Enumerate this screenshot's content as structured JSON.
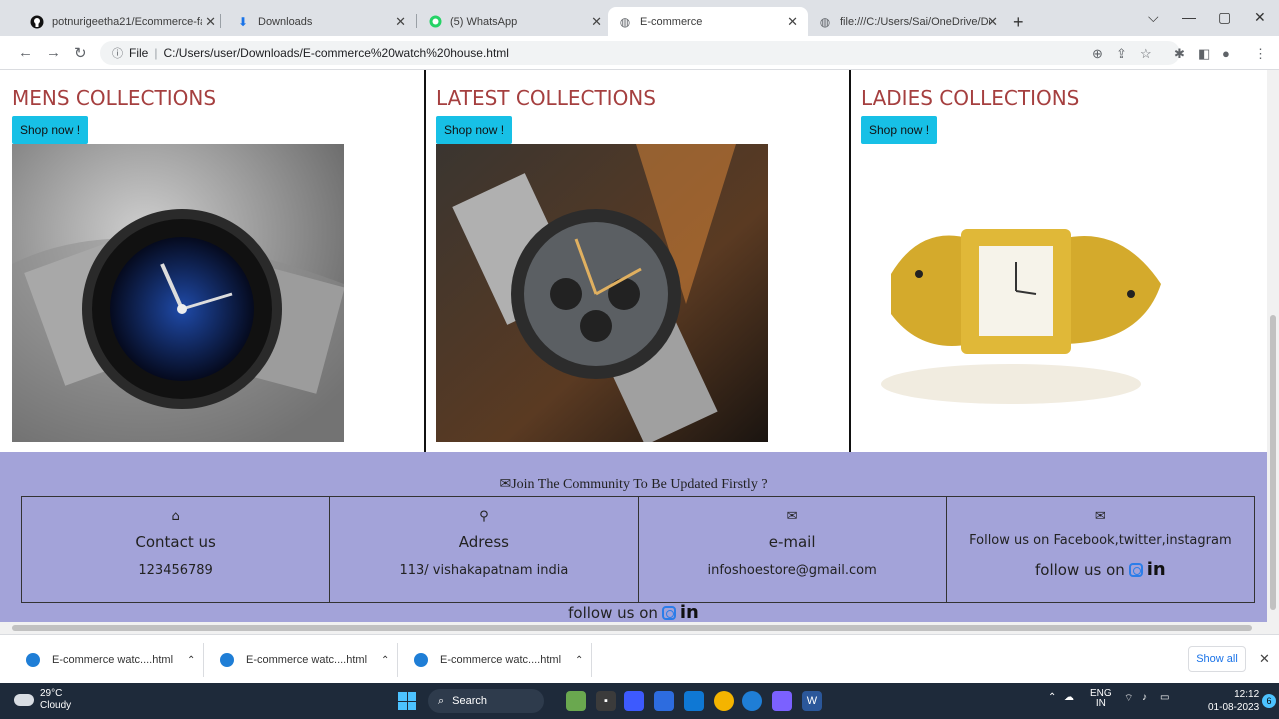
{
  "browser": {
    "tabs": [
      {
        "title": "potnurigeetha21/Ecommerce-fa",
        "icon": "github-icon"
      },
      {
        "title": "Downloads",
        "icon": "download-icon"
      },
      {
        "title": "(5) WhatsApp",
        "icon": "whatsapp-icon"
      },
      {
        "title": "E-commerce",
        "icon": "globe-icon"
      },
      {
        "title": "file:///C:/Users/Sai/OneDrive/De",
        "icon": "globe-icon"
      }
    ],
    "active_tab": 3,
    "address_prefix": "File",
    "url": "C:/Users/user/Downloads/E-commerce%20watch%20house.html"
  },
  "collections": [
    {
      "title": "MENS COLLECTIONS",
      "button": "Shop now !"
    },
    {
      "title": "LATEST COLLECTIONS",
      "button": "Shop now !"
    },
    {
      "title": "LADIES COLLECTIONS",
      "button": "Shop now !"
    }
  ],
  "footer": {
    "join_text": "Join The Community To Be Updated Firstly ?",
    "cells": [
      {
        "icon": "home-icon",
        "title": "Contact us",
        "value": "123456789"
      },
      {
        "icon": "location-pin-icon",
        "title": "Adress",
        "value": "113/ vishakapatnam india"
      },
      {
        "icon": "envelope-icon",
        "title": "e-mail",
        "value": "infoshoestore@gmail.com"
      },
      {
        "icon": "envelope-icon",
        "title": "Follow us on Facebook,twitter,instagram",
        "value": "follow us on"
      }
    ],
    "follow_bottom": "follow us on",
    "linkedin": "in"
  },
  "downloads": {
    "items": [
      "E-commerce watc....html",
      "E-commerce watc....html",
      "E-commerce watc....html"
    ],
    "show_all": "Show all"
  },
  "taskbar": {
    "temperature": "29°C",
    "weather": "Cloudy",
    "search": "Search",
    "lang_top": "ENG",
    "lang_bottom": "IN",
    "time": "12:12",
    "date": "01-08-2023",
    "notifications": "6"
  },
  "colors": {
    "heading": "#a53f3f",
    "button": "#17c0e6",
    "footer_bg": "#a3a3d9"
  }
}
